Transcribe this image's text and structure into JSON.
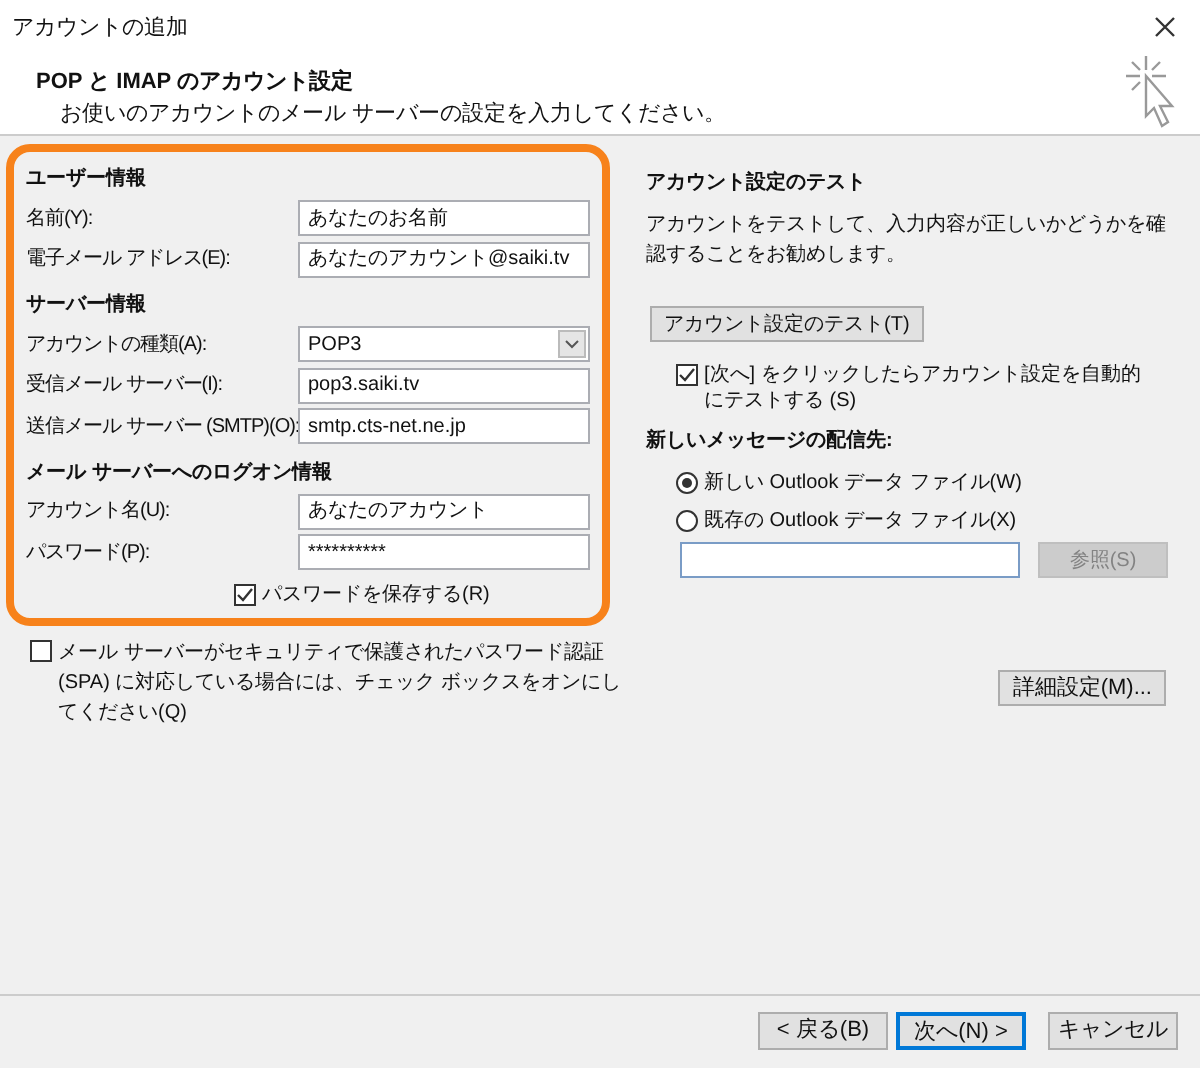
{
  "window": {
    "title": "アカウントの追加"
  },
  "header": {
    "title": "POP と IMAP のアカウント設定",
    "subtitle": "お使いのアカウントのメール サーバーの設定を入力してください。"
  },
  "sections": [
    {
      "heading": "ユーザー情報",
      "fields": [
        {
          "kind": "text",
          "label": "名前(Y):",
          "value": "あなたのお名前"
        },
        {
          "kind": "text",
          "label": "電子メール アドレス(E):",
          "value": "あなたのアカウント@saiki.tv"
        }
      ]
    },
    {
      "heading": "サーバー情報",
      "fields": [
        {
          "kind": "select",
          "label": "アカウントの種類(A):",
          "value": "POP3"
        },
        {
          "kind": "text",
          "label": "受信メール サーバー(I):",
          "value": "pop3.saiki.tv"
        },
        {
          "kind": "text",
          "label": "送信メール サーバー (SMTP)(O):",
          "value": "smtp.cts-net.ne.jp"
        }
      ]
    },
    {
      "heading": "メール サーバーへのログオン情報",
      "fields": [
        {
          "kind": "text",
          "label": "アカウント名(U):",
          "value": "あなたのアカウント"
        },
        {
          "kind": "text",
          "label": "パスワード(P):",
          "value": "**********"
        }
      ]
    }
  ],
  "save_password": {
    "label": "パスワードを保存する(R)",
    "checked": true
  },
  "spa": {
    "label": "メール サーバーがセキュリティで保護されたパスワード認証 (SPA) に対応している場合には、チェック ボックスをオンにしてください(Q)",
    "checked": false
  },
  "test": {
    "heading": "アカウント設定のテスト",
    "description": "アカウントをテストして、入力内容が正しいかどうかを確認することをお勧めします。",
    "button": "アカウント設定のテスト(T)",
    "auto_test": {
      "label": "[次へ] をクリックしたらアカウント設定を自動的にテストする (S)",
      "checked": true
    }
  },
  "delivery": {
    "heading": "新しいメッセージの配信先:",
    "options": [
      {
        "label": "新しい Outlook データ ファイル(W)",
        "selected": true
      },
      {
        "label": "既存の Outlook データ ファイル(X)",
        "selected": false
      }
    ],
    "browse_button": {
      "label": "参照(S)",
      "disabled": true
    }
  },
  "more_settings": "詳細設定(M)...",
  "buttons": [
    {
      "label": "< 戻る(B)",
      "default": false
    },
    {
      "label": "次へ(N) >",
      "default": true
    },
    {
      "label": "キャンセル",
      "default": false
    }
  ]
}
